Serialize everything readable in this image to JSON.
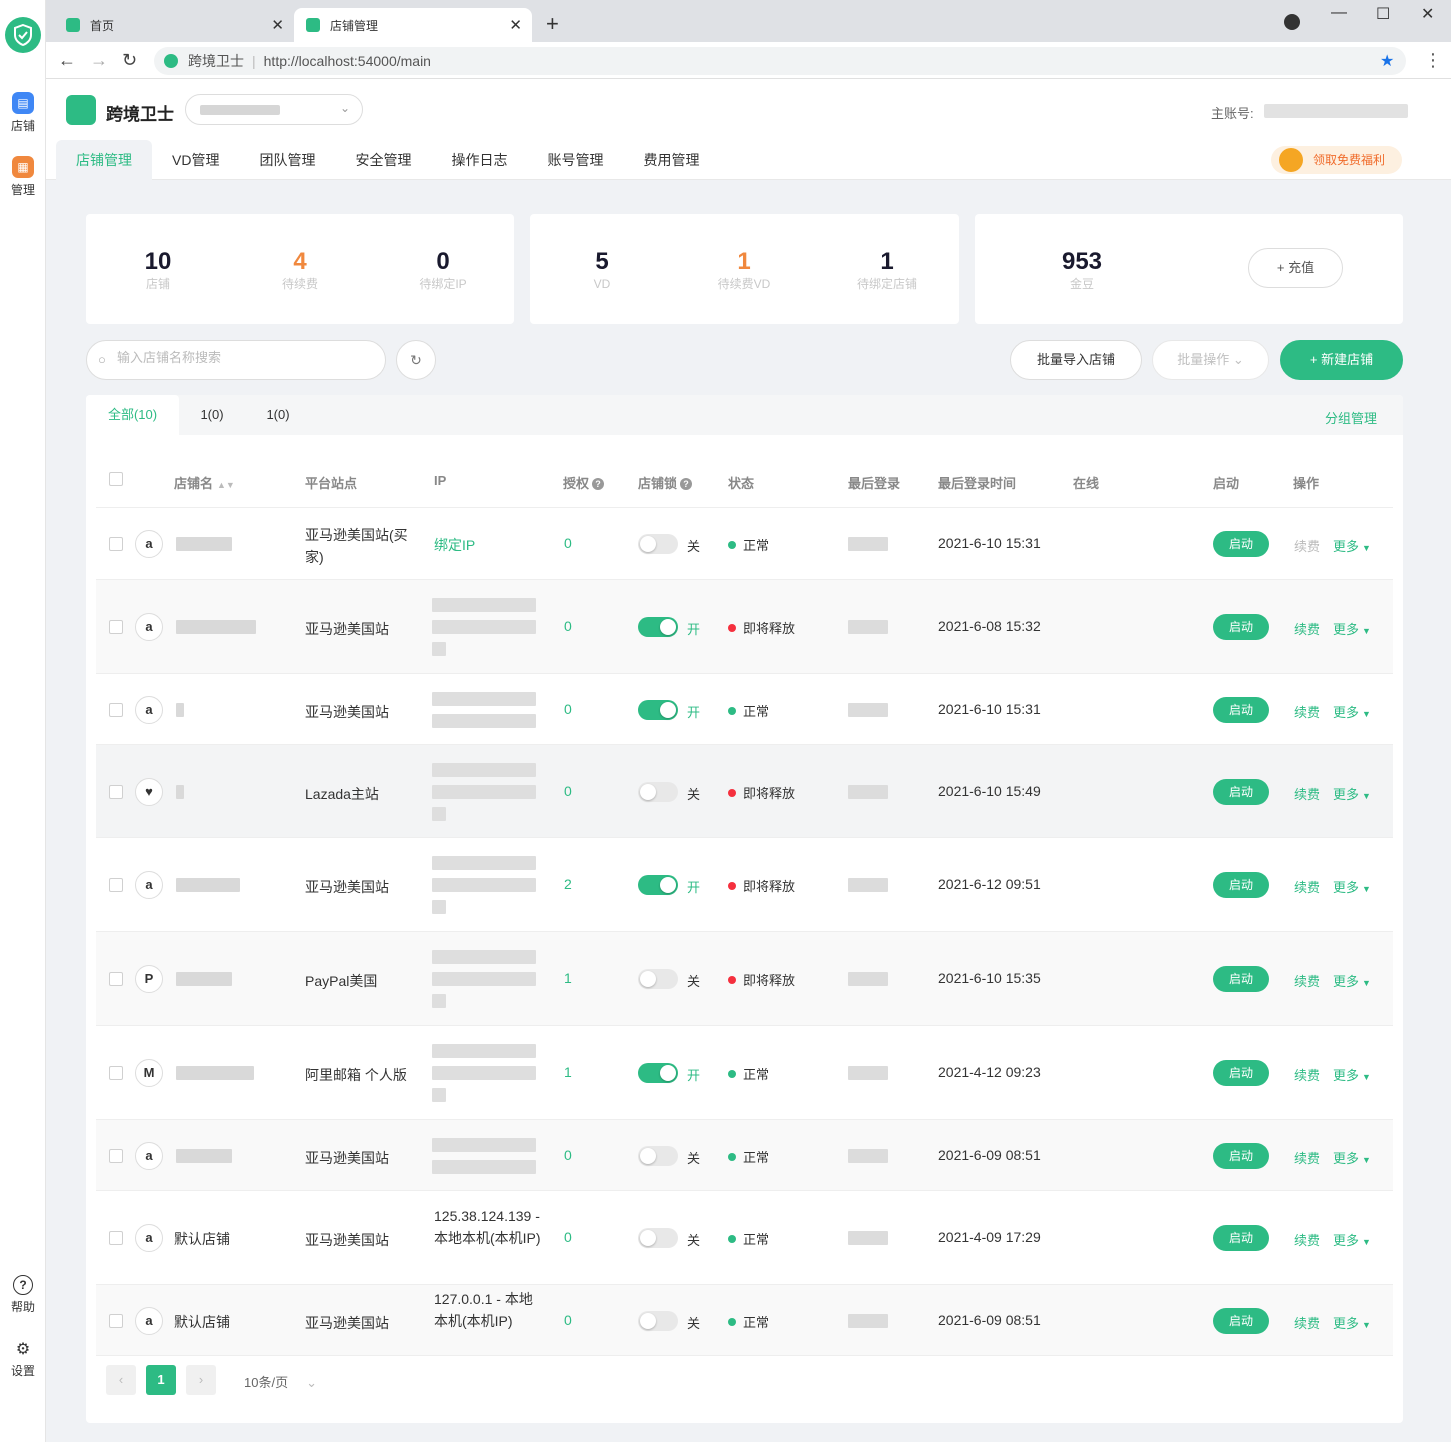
{
  "browser": {
    "tabs": [
      {
        "label": "首页"
      },
      {
        "label": "店铺管理"
      }
    ],
    "new_tab": "+",
    "site_name": "跨境卫士",
    "url": "http://localhost:54000/main"
  },
  "rail": {
    "items": [
      {
        "label": "店铺",
        "icon": "store-icon",
        "color": "#3f87f5"
      },
      {
        "label": "管理",
        "icon": "manage-icon",
        "color": "#f0883e"
      },
      {
        "label": "帮助",
        "icon": "help-icon"
      },
      {
        "label": "设置",
        "icon": "settings-icon"
      }
    ]
  },
  "header": {
    "brand": "跨境卫士",
    "main_account_label": "主账号:",
    "nav": [
      {
        "label": "店铺管理",
        "active": true
      },
      {
        "label": "VD管理"
      },
      {
        "label": "团队管理"
      },
      {
        "label": "安全管理"
      },
      {
        "label": "操作日志"
      },
      {
        "label": "账号管理"
      },
      {
        "label": "费用管理"
      }
    ],
    "promo": "领取免费福利"
  },
  "stats": {
    "card1": [
      {
        "value": "10",
        "label": "店铺"
      },
      {
        "value": "4",
        "label": "待续费"
      },
      {
        "value": "0",
        "label": "待绑定IP"
      }
    ],
    "card2": [
      {
        "value": "5",
        "label": "VD"
      },
      {
        "value": "1",
        "label": "待续费VD"
      },
      {
        "value": "1",
        "label": "待绑定店铺"
      }
    ],
    "card3": {
      "value": "953",
      "label": "金豆",
      "recharge": "+ 充值"
    }
  },
  "toolbar": {
    "search_placeholder": "输入店铺名称搜索",
    "import": "批量导入店铺",
    "batch": "批量操作",
    "create": "+ 新建店铺"
  },
  "groups": {
    "tabs": [
      {
        "label": "全部(10)"
      },
      {
        "label": "1(0)"
      },
      {
        "label": "1(0)"
      }
    ],
    "manage": "分组管理"
  },
  "table": {
    "headers": [
      "店铺名",
      "平台站点",
      "IP",
      "授权",
      "店铺锁",
      "状态",
      "最后登录",
      "最后登录时间",
      "在线",
      "启动",
      "操作"
    ],
    "start_label": "启动",
    "renew_label": "续费",
    "more_label": "更多",
    "lock_on": "开",
    "lock_off": "关",
    "rows": [
      {
        "platform_icon": "amazon-icon",
        "platform_glyph": "a",
        "name": "",
        "site": "亚马逊美国站(买家)",
        "ip": "绑定IP",
        "auth": "0",
        "lock": false,
        "status": "正常",
        "status_type": "ok",
        "time": "2021-6-10 15:31",
        "renew_enabled": false
      },
      {
        "platform_icon": "amazon-icon",
        "platform_glyph": "a",
        "name": "",
        "site": "亚马逊美国站",
        "ip": "",
        "auth": "0",
        "lock": true,
        "status": "即将释放",
        "status_type": "warn",
        "time": "2021-6-08 15:32",
        "renew_enabled": true
      },
      {
        "platform_icon": "amazon-icon",
        "platform_glyph": "a",
        "name": "",
        "site": "亚马逊美国站",
        "ip": "",
        "auth": "0",
        "lock": true,
        "status": "正常",
        "status_type": "ok",
        "time": "2021-6-10 15:31",
        "renew_enabled": true
      },
      {
        "platform_icon": "lazada-icon",
        "platform_glyph": "♥",
        "name": "",
        "site": "Lazada主站",
        "ip": "",
        "auth": "0",
        "lock": false,
        "status": "即将释放",
        "status_type": "warn",
        "time": "2021-6-10 15:49",
        "renew_enabled": true
      },
      {
        "platform_icon": "amazon-icon",
        "platform_glyph": "a",
        "name": "",
        "site": "亚马逊美国站",
        "ip": "",
        "auth": "2",
        "lock": true,
        "status": "即将释放",
        "status_type": "warn",
        "time": "2021-6-12 09:51",
        "renew_enabled": true
      },
      {
        "platform_icon": "paypal-icon",
        "platform_glyph": "P",
        "name": "",
        "site": "PayPal美国",
        "ip": "",
        "auth": "1",
        "lock": false,
        "status": "即将释放",
        "status_type": "warn",
        "time": "2021-6-10 15:35",
        "renew_enabled": true
      },
      {
        "platform_icon": "mail-icon",
        "platform_glyph": "M",
        "name": "",
        "site": "阿里邮箱 个人版",
        "ip": "",
        "auth": "1",
        "lock": true,
        "status": "正常",
        "status_type": "ok",
        "time": "2021-4-12 09:23",
        "renew_enabled": true
      },
      {
        "platform_icon": "amazon-icon",
        "platform_glyph": "a",
        "name": "",
        "site": "亚马逊美国站",
        "ip": "",
        "auth": "0",
        "lock": false,
        "status": "正常",
        "status_type": "ok",
        "time": "2021-6-09 08:51",
        "renew_enabled": true
      },
      {
        "platform_icon": "amazon-icon",
        "platform_glyph": "a",
        "name": "默认店铺",
        "site": "亚马逊美国站",
        "ip": "125.38.124.139 - 本地本机(本机IP)",
        "auth": "0",
        "lock": false,
        "status": "正常",
        "status_type": "ok",
        "time": "2021-4-09 17:29",
        "renew_enabled": true
      },
      {
        "platform_icon": "amazon-icon",
        "platform_glyph": "a",
        "name": "默认店铺",
        "site": "亚马逊美国站",
        "ip": "127.0.0.1 - 本地本机(本机IP)",
        "auth": "0",
        "lock": false,
        "status": "正常",
        "status_type": "ok",
        "time": "2021-6-09 08:51",
        "renew_enabled": true
      }
    ]
  },
  "pagination": {
    "current": "1",
    "prev": "‹",
    "next": "›",
    "page_size": "10条/页"
  },
  "colors": {
    "accent": "#2dbb84",
    "warn": "#f5303e",
    "orange": "#f0883e"
  }
}
